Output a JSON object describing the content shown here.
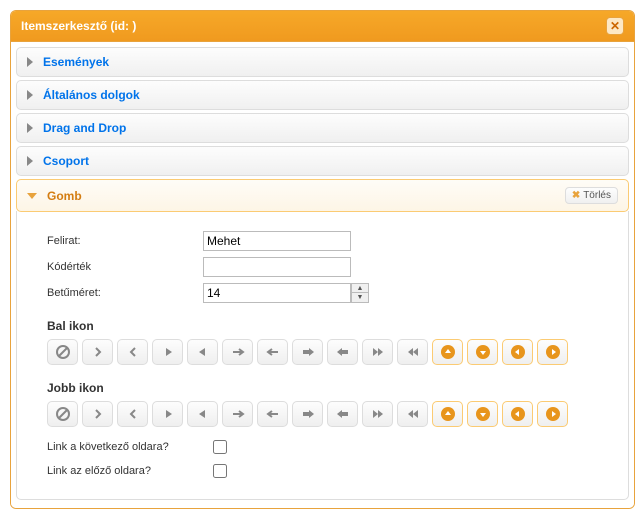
{
  "title": "Itemszerkesztő (id:  )",
  "accordion": {
    "items": [
      {
        "label": "Események"
      },
      {
        "label": "Általános dolgok"
      },
      {
        "label": "Drag and Drop"
      },
      {
        "label": "Csoport"
      },
      {
        "label": "Gomb"
      }
    ],
    "delete_label": "Törlés"
  },
  "form": {
    "caption_label": "Felirat:",
    "caption_value": "Mehet",
    "codevalue_label": "Kódérték",
    "codevalue_value": "",
    "fontsize_label": "Betűméret:",
    "fontsize_value": "14",
    "lefticon_label": "Bal ikon",
    "righticon_label": "Jobb ikon",
    "link_next_label": "Link a következő oldara?",
    "link_prev_label": "Link az előző oldara?"
  },
  "icon_set": [
    "cancel",
    "chevron-right",
    "chevron-left",
    "triangle-right",
    "triangle-left",
    "arrow-right-thin",
    "arrow-left-thin",
    "arrow-right",
    "arrow-left",
    "fast-forward",
    "rewind",
    "circle-up",
    "circle-down",
    "circle-left",
    "circle-right"
  ],
  "colors": {
    "accent": "#f6a828",
    "link": "#0073ea",
    "icon_gray": "#888888",
    "icon_orange": "#e8951c"
  }
}
